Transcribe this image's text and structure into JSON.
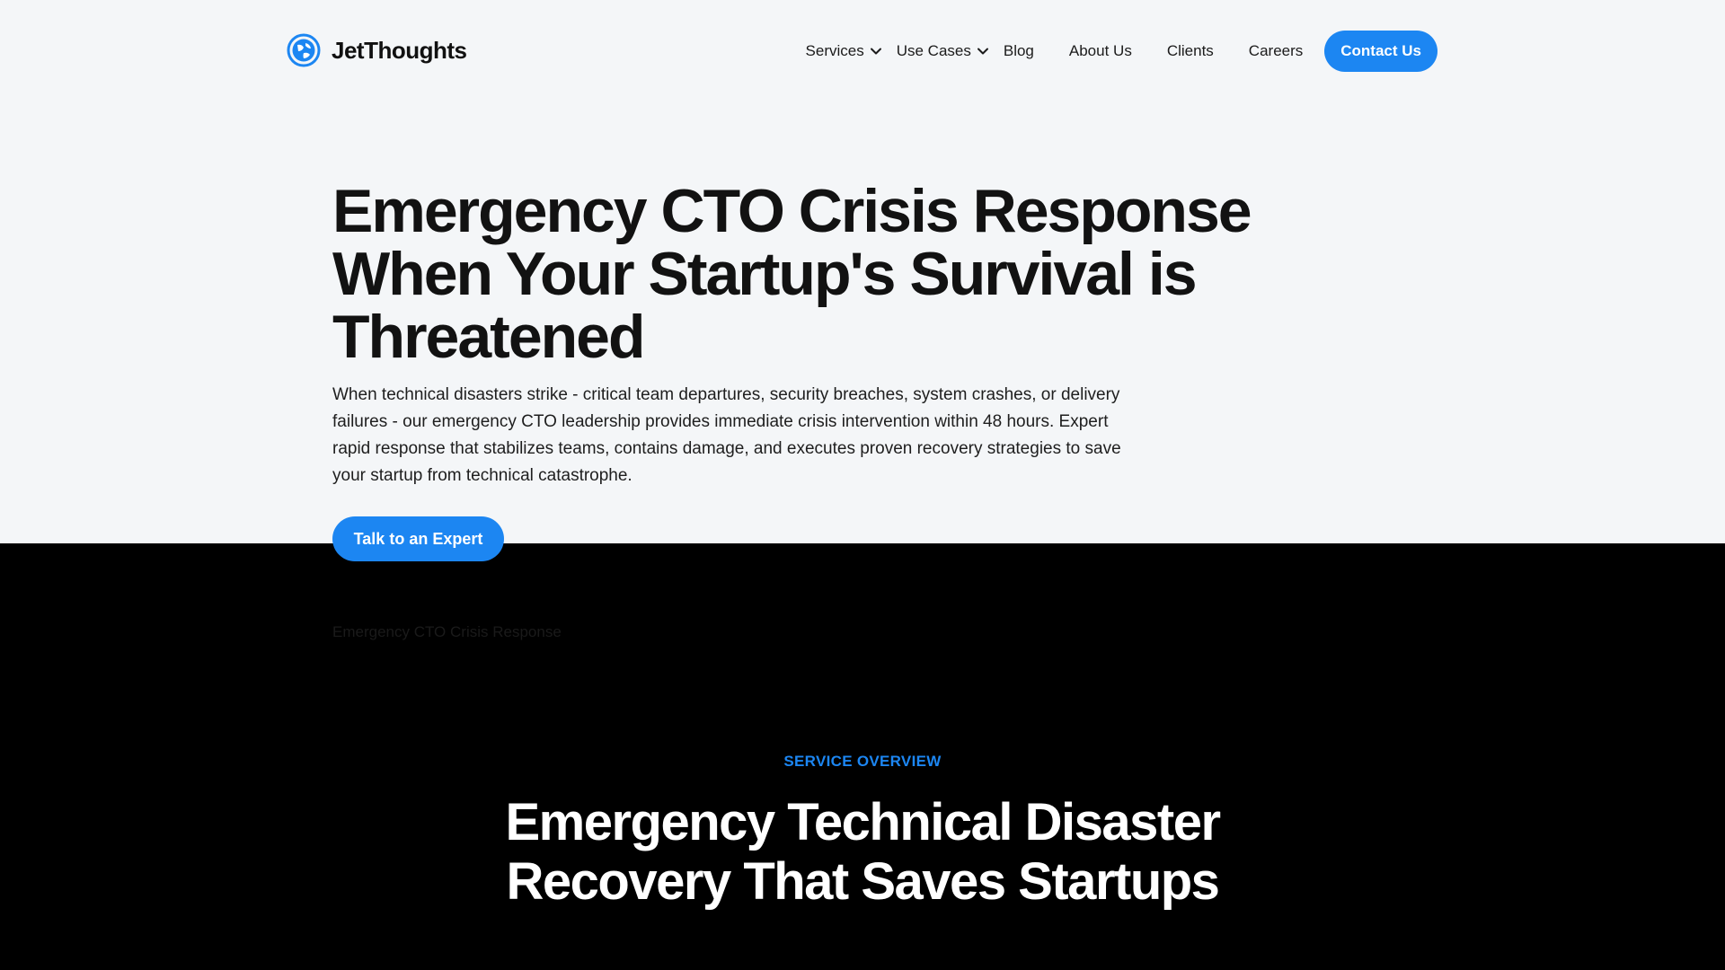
{
  "brand": {
    "name": "JetThoughts",
    "logo_icon": "globe-logo-icon",
    "accent_color": "#1c86f2"
  },
  "nav": {
    "services": "Services",
    "use_cases": "Use Cases",
    "blog": "Blog",
    "about": "About Us",
    "clients": "Clients",
    "careers": "Careers",
    "contact": "Contact Us"
  },
  "hero": {
    "title": "Emergency CTO Crisis Response When Your Startup's Survival is Threatened",
    "description": "When technical disasters strike - critical team departures, security breaches, system crashes, or delivery failures - our emergency CTO leadership provides immediate crisis intervention within 48 hours. Expert rapid response that stabilizes teams, contains damage, and executes proven recovery strategies to save your startup from technical catastrophe.",
    "cta": "Talk to an Expert"
  },
  "breadcrumb": {
    "current": "Emergency CTO Crisis Response"
  },
  "overview": {
    "eyebrow": "SERVICE OVERVIEW",
    "title": "Emergency Technical Disaster Recovery That Saves Startups"
  }
}
